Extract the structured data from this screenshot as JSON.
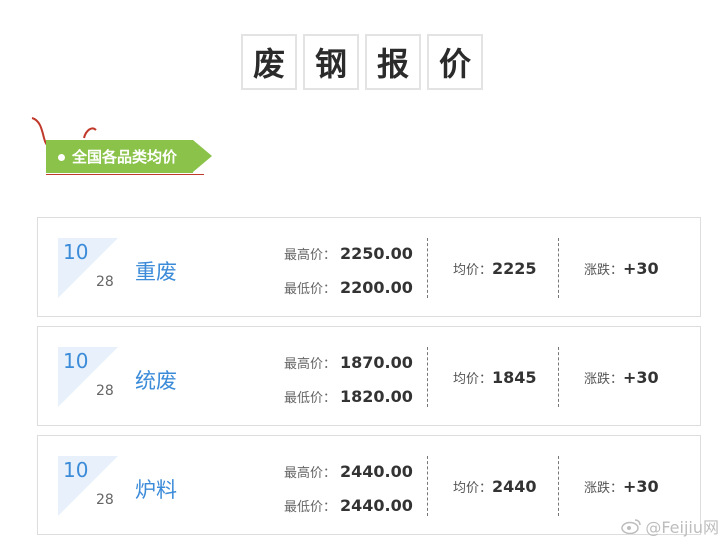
{
  "title_chars": [
    "废",
    "钢",
    "报",
    "价"
  ],
  "section_tag": "全国各品类均价",
  "labels": {
    "max": "最高价：",
    "min": "最低价：",
    "avg": "均价：",
    "change": "涨跌："
  },
  "cards": [
    {
      "month": "10",
      "day": "28",
      "name": "重废",
      "max": "2250.00",
      "min": "2200.00",
      "avg": "2225",
      "change": "+30"
    },
    {
      "month": "10",
      "day": "28",
      "name": "统废",
      "max": "1870.00",
      "min": "1820.00",
      "avg": "1845",
      "change": "+30"
    },
    {
      "month": "10",
      "day": "28",
      "name": "炉料",
      "max": "2440.00",
      "min": "2440.00",
      "avg": "2440",
      "change": "+30"
    }
  ],
  "watermark": "@Feijiu网",
  "colors": {
    "accent_blue": "#3b8bd9",
    "tag_green": "#8bc34a",
    "ribbon_red": "#c0392b"
  }
}
